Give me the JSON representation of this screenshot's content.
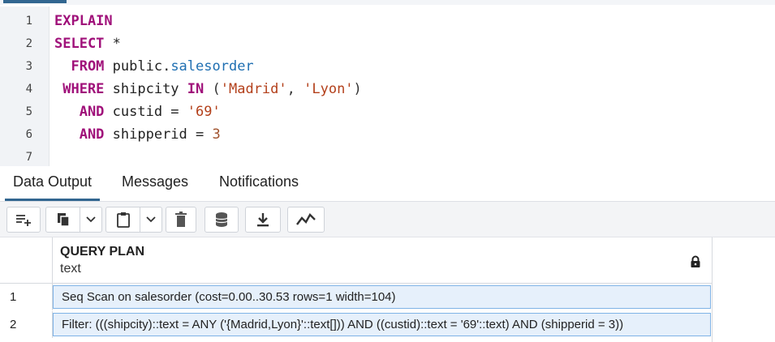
{
  "editor": {
    "lines": [
      {
        "num": "1",
        "tokens": [
          {
            "t": "EXPLAIN",
            "c": "kw"
          }
        ]
      },
      {
        "num": "2",
        "tokens": [
          {
            "t": "SELECT",
            "c": "kw"
          },
          {
            "t": " *",
            "c": "plain"
          }
        ]
      },
      {
        "num": "3",
        "tokens": [
          {
            "t": "  FROM",
            "c": "kw"
          },
          {
            "t": " public.",
            "c": "plain"
          },
          {
            "t": "salesorder",
            "c": "ident"
          }
        ]
      },
      {
        "num": "4",
        "tokens": [
          {
            "t": " WHERE",
            "c": "kw"
          },
          {
            "t": " shipcity ",
            "c": "plain"
          },
          {
            "t": "IN",
            "c": "kw"
          },
          {
            "t": " (",
            "c": "op"
          },
          {
            "t": "'Madrid'",
            "c": "str"
          },
          {
            "t": ", ",
            "c": "op"
          },
          {
            "t": "'Lyon'",
            "c": "str"
          },
          {
            "t": ")",
            "c": "op"
          }
        ]
      },
      {
        "num": "5",
        "tokens": [
          {
            "t": "   AND",
            "c": "kw"
          },
          {
            "t": " custid = ",
            "c": "plain"
          },
          {
            "t": "'69'",
            "c": "str"
          }
        ]
      },
      {
        "num": "6",
        "tokens": [
          {
            "t": "   AND",
            "c": "kw"
          },
          {
            "t": " shipperid = ",
            "c": "plain"
          },
          {
            "t": "3",
            "c": "num"
          }
        ]
      },
      {
        "num": "7",
        "tokens": []
      }
    ]
  },
  "tabs": [
    {
      "label": "Data Output",
      "active": true
    },
    {
      "label": "Messages",
      "active": false
    },
    {
      "label": "Notifications",
      "active": false
    }
  ],
  "toolbar": {
    "icons": [
      "add-row-icon",
      "copy-icon",
      "paste-icon",
      "delete-icon",
      "save-data-icon",
      "download-icon",
      "graph-visualiser-icon"
    ]
  },
  "grid": {
    "column": {
      "title": "QUERY PLAN",
      "type": "text"
    },
    "rows": [
      {
        "num": "1",
        "value": "Seq Scan on salesorder  (cost=0.00..30.53 rows=1 width=104)"
      },
      {
        "num": "2",
        "value": "  Filter: (((shipcity)::text = ANY ('{Madrid,Lyon}'::text[])) AND ((custid)::text = '69'::text) AND (shipperid = 3))"
      }
    ]
  },
  "colors": {
    "accent": "#326690",
    "keyword": "#a0117a",
    "string": "#b3401b",
    "identifier": "#1f6fb2",
    "selected_cell": "#e6f0fb"
  }
}
